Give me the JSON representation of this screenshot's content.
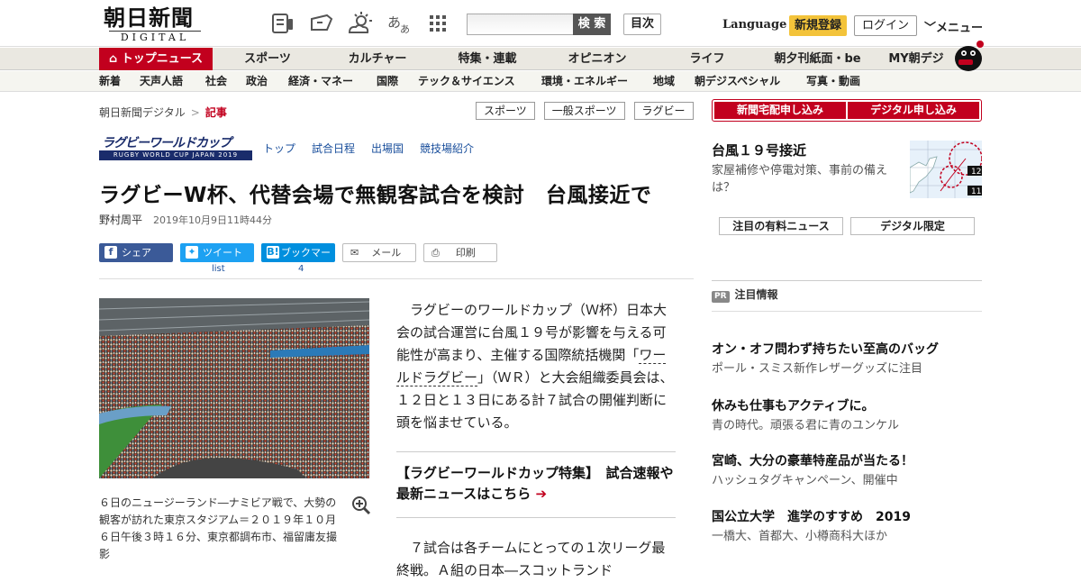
{
  "header": {
    "logo_kanji": "朝日新聞",
    "logo_sub": "DIGITAL",
    "search_button": "検 索",
    "toc": "目次",
    "language": "Language",
    "register": "新規登録",
    "login": "ログイン",
    "menu": "メニュー"
  },
  "nav_primary": [
    "トップニュース",
    "スポーツ",
    "カルチャー",
    "特集・連載",
    "オピニオン",
    "ライフ",
    "朝夕刊紙面・be",
    "MY朝デジ"
  ],
  "nav_secondary": [
    "新着",
    "天声人語",
    "社会",
    "政治",
    "経済・マネー",
    "国際",
    "テック＆サイエンス",
    "環境・エネルギー",
    "地域",
    "朝デジスペシャル",
    "写真・動画"
  ],
  "breadcrumb": {
    "home": "朝日新聞デジタル",
    "sep": ">",
    "current": "記事"
  },
  "tags": [
    "スポーツ",
    "一般スポーツ",
    "ラグビー"
  ],
  "rwc": {
    "logo_main": "ラグビーワールドカップ",
    "logo_sub": "RUGBY WORLD CUP JAPAN 2019",
    "links": [
      "トップ",
      "試合日程",
      "出場国",
      "競技場紹介"
    ]
  },
  "article": {
    "headline": "ラグビーW杯、代替会場で無観客試合を検討　台風接近で",
    "author": "野村周平",
    "date": "2019年10月9日11時44分",
    "share": {
      "facebook": "シェア",
      "twitter": "ツイート",
      "twitter_count": "list",
      "hatena": "ブックマーク",
      "hatena_count": "4",
      "mail": "メール",
      "print": "印刷"
    },
    "caption": "６日のニュージーランド―ナミビア戦で、大勢の観客が訪れた東京スタジアム＝２０１９年１０月６日午後３時１６分、東京都調布市、福留庸友撮影",
    "para1_a": "ラグビーのワールドカップ（Ｗ杯）日本大会の試合運営に台風１９号が影響を与える可能性が高まり、主催する国際統括機関「",
    "para1_link": "ワールドラグビー",
    "para1_b": "」（ＷＲ）と大会組織委員会は、１２日と１３日にある計７試合の開催判断に頭を悩ませている。",
    "feature": "【ラグビーワールドカップ特集】　試合速報や最新ニュースはこちら",
    "para2": "７試合は各チームにとっての１次リーグ最終戦。Ａ組の日本―スコットランド"
  },
  "sidebar": {
    "subscribe_paper": "新聞宅配申し込み",
    "subscribe_digital": "デジタル申し込み",
    "typhoon_title": "台風１９号接近",
    "typhoon_desc": "家屋補修や停電対策、事前の備えは？",
    "map_labels": [
      "12",
      "11"
    ],
    "btn_paid": "注目の有料ニュース",
    "btn_digital": "デジタル限定",
    "pr_badge": "PR",
    "pr_title": "注目情報",
    "ads": [
      {
        "title": "オン・オフ問わず持ちたい至高のバッグ",
        "sub": "ポール・スミス新作レザーグッズに注目"
      },
      {
        "title": "休みも仕事もアクティブに。",
        "sub": "青の時代。頑張る君に青のユンケル"
      },
      {
        "title": "宮崎、大分の豪華特産品が当たる！",
        "sub": "ハッシュタグキャンペーン、開催中"
      },
      {
        "title": "国公立大学　進学のすすめ　2019",
        "sub": "一橋大、首都大、小樽商科大ほか"
      }
    ]
  },
  "colors": {
    "brand_red": "#c2001e",
    "facebook": "#3b5a98",
    "twitter": "#1da1f2",
    "hatena": "#008fde",
    "register_yellow": "#f3c33a"
  }
}
